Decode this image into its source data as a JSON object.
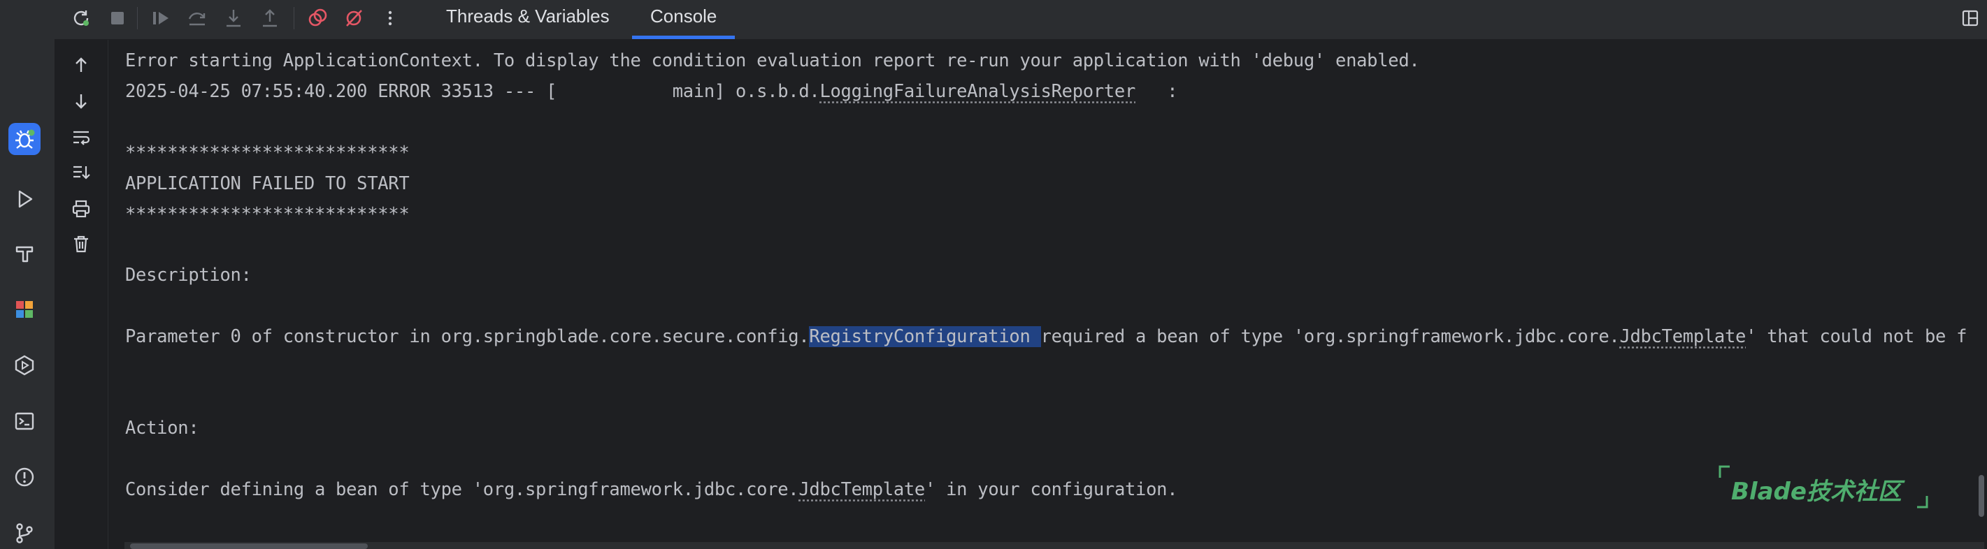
{
  "tabs": [
    {
      "label": "Threads & Variables"
    },
    {
      "label": "Console"
    }
  ],
  "active_tab": "Console",
  "toolbar_icons": [
    "rerun-icon",
    "stop-icon",
    "resume-icon",
    "step-over-icon",
    "step-into-icon",
    "step-out-icon",
    "view-breakpoints-icon",
    "mute-breakpoints-icon",
    "more-icon"
  ],
  "sidebar_icons": [
    "debug-icon",
    "run-icon",
    "build-icon",
    "plugins-icon",
    "services-icon",
    "terminal-icon",
    "problems-icon",
    "git-icon"
  ],
  "console_actions": [
    "scroll-up-icon",
    "scroll-down-icon",
    "soft-wrap-icon",
    "scroll-to-end-icon",
    "print-icon",
    "clear-icon"
  ],
  "console": {
    "l1": "Error starting ApplicationContext. To display the condition evaluation report re-run your application with 'debug' enabled.",
    "l2_pre": "2025-04-25 07:55:40.200 ERROR 33513 --- [           main] o.s.b.d.",
    "l2_link": "LoggingFailureAnalysisReporter",
    "l2_post": "   :",
    "stars": "***************************",
    "failed": "APPLICATION FAILED TO START",
    "description": "Description:",
    "param_pre": "Parameter 0 of constructor in org.springblade.core.secure.config.",
    "param_sel": "RegistryConfiguration ",
    "param_mid": "required a bean of type 'org.springframework.jdbc.core.",
    "param_link": "JdbcTemplate",
    "param_post": "' that could not be found.",
    "action": "Action:",
    "consider_pre": "Consider defining a bean of type 'org.springframework.jdbc.core.",
    "consider_link": "JdbcTemplate",
    "consider_post": "' in your configuration."
  },
  "watermark": "Blade技术社区",
  "colors": {
    "accent": "#3574f0",
    "error_red": "#e55765",
    "console_text": "#bcbec4",
    "selection": "#214283",
    "watermark_green": "#4fae6e"
  }
}
